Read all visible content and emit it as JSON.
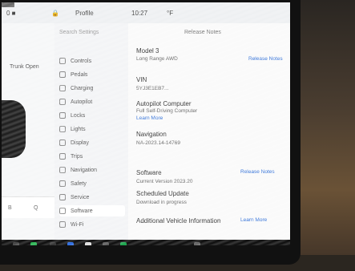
{
  "statusbar": {
    "speed": "0 ■",
    "lock_icon": "lock-icon",
    "profile": "Profile",
    "time": "10:27",
    "temp": "°F"
  },
  "car_panel": {
    "label": "Trunk Open",
    "bottom_left": "B",
    "bottom_right": "Q"
  },
  "menu": {
    "search_placeholder": "Search Settings",
    "items": [
      {
        "label": "Controls",
        "icon": "toggle-icon"
      },
      {
        "label": "Pedals",
        "icon": "car-icon"
      },
      {
        "label": "Charging",
        "icon": "bolt-icon"
      },
      {
        "label": "Autopilot",
        "icon": "steering-icon"
      },
      {
        "label": "Locks",
        "icon": "lock-icon"
      },
      {
        "label": "Lights",
        "icon": "light-icon"
      },
      {
        "label": "Display",
        "icon": "display-icon"
      },
      {
        "label": "Trips",
        "icon": "route-icon"
      },
      {
        "label": "Navigation",
        "icon": "nav-icon"
      },
      {
        "label": "Safety",
        "icon": "shield-icon"
      },
      {
        "label": "Service",
        "icon": "wrench-icon"
      },
      {
        "label": "Software",
        "icon": "download-icon"
      },
      {
        "label": "Wi-Fi",
        "icon": "wifi-icon"
      }
    ],
    "active_index": 11
  },
  "content": {
    "top_buttons": [
      "Release Notes"
    ],
    "sections": [
      {
        "title": "Model 3",
        "text": "Long Range AWD",
        "link": "Release Notes"
      },
      {
        "title": "VIN",
        "text": "5YJ3E1EB7..."
      },
      {
        "title": "Autopilot Computer",
        "text": "Full Self-Driving Computer",
        "link": "Learn More"
      },
      {
        "title": "Navigation",
        "text": "NA-2023.14-14769"
      },
      {
        "title": "Software",
        "text": "Current Version 2023.20",
        "link": "Release Notes"
      },
      {
        "title": "Scheduled Update",
        "text": "Download in progress"
      },
      {
        "title": "Additional Vehicle Information",
        "link": "Learn More"
      }
    ]
  },
  "dock": {
    "icons": [
      "car-icon",
      "phone-icon",
      "camera-icon",
      "bluetooth-icon",
      "app-icon",
      "grid-icon",
      "music-icon",
      "volume-icon"
    ]
  }
}
